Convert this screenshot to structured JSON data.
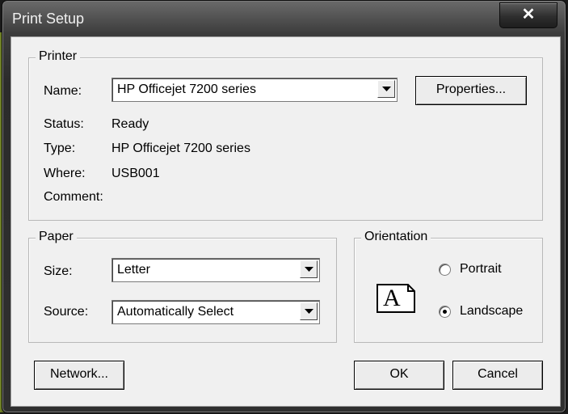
{
  "window": {
    "title": "Print Setup",
    "close_symbol": "✕"
  },
  "printer": {
    "legend": "Printer",
    "name_label": "Name:",
    "name_value": "HP Officejet 7200 series",
    "properties_button": "Properties...",
    "status_label": "Status:",
    "status_value": "Ready",
    "type_label": "Type:",
    "type_value": "HP Officejet 7200 series",
    "where_label": "Where:",
    "where_value": "USB001",
    "comment_label": "Comment:",
    "comment_value": ""
  },
  "paper": {
    "legend": "Paper",
    "size_label": "Size:",
    "size_value": "Letter",
    "source_label": "Source:",
    "source_value": "Automatically Select"
  },
  "orientation": {
    "legend": "Orientation",
    "icon_letter": "A",
    "portrait_label": "Portrait",
    "landscape_label": "Landscape",
    "selected": "Landscape"
  },
  "buttons": {
    "network": "Network...",
    "ok": "OK",
    "cancel": "Cancel"
  }
}
